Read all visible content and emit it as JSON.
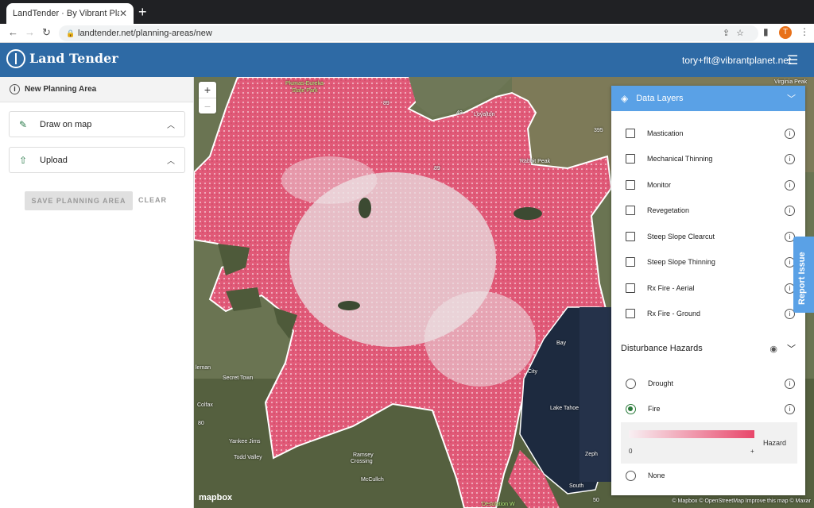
{
  "browser": {
    "tab_title": "LandTender · By Vibrant Planet",
    "url": "landtender.net/planning-areas/new",
    "profile_initial": "T"
  },
  "header": {
    "app_name": "Land Tender",
    "user_email": "tory+flt@vibrantplanet.net"
  },
  "sidebar": {
    "section_title": "New Planning Area",
    "draw_label": "Draw on map",
    "upload_label": "Upload",
    "save_label": "SAVE PLANNING AREA",
    "clear_label": "CLEAR"
  },
  "map": {
    "zoom_in": "+",
    "zoom_out": "−",
    "labels": {
      "plumas": "Plumas-Eureka",
      "state_park": "State Park",
      "loyalton": "Loyalton",
      "rabbit": "Rabbit Peak",
      "virginia": "Virginia Peak",
      "colfax": "Colfax",
      "secret_town": "Secret Town",
      "yankee_jims": "Yankee Jims",
      "todd_valley": "Todd Valley",
      "ramsey": "Ramsey",
      "crossing": "Crossing",
      "mcculloch": "McCullch",
      "lake_tahoe": "Lake Tahoe",
      "city": "City",
      "bay": "Bay",
      "zepher": "Zeph",
      "south": "South",
      "desolation": "Desolation W",
      "leman": "leman",
      "r89a": "89",
      "r89b": "89",
      "r49": "49",
      "r395": "395",
      "r80": "80",
      "r50": "50"
    },
    "mapbox_logo": "mapbox",
    "attribution": "© Mapbox © OpenStreetMap Improve this map © Maxar"
  },
  "data_layers": {
    "title": "Data Layers",
    "treatments": [
      {
        "label": "Mastication"
      },
      {
        "label": "Mechanical Thinning"
      },
      {
        "label": "Monitor"
      },
      {
        "label": "Revegetation"
      },
      {
        "label": "Steep Slope Clearcut"
      },
      {
        "label": "Steep Slope Thinning"
      },
      {
        "label": "Rx Fire - Aerial"
      },
      {
        "label": "Rx Fire - Ground"
      }
    ],
    "hazards_title": "Disturbance Hazards",
    "hazards": [
      {
        "label": "Drought",
        "selected": false
      },
      {
        "label": "Fire",
        "selected": true
      },
      {
        "label": "None",
        "selected": false
      }
    ],
    "legend": {
      "low": "0",
      "high": "+",
      "name": "Hazard"
    }
  },
  "report_issue": "Report Issue",
  "colors": {
    "brand_blue": "#2e6aa5",
    "panel_blue": "#5aa1e6",
    "hazard_pink": "#e8466a"
  }
}
